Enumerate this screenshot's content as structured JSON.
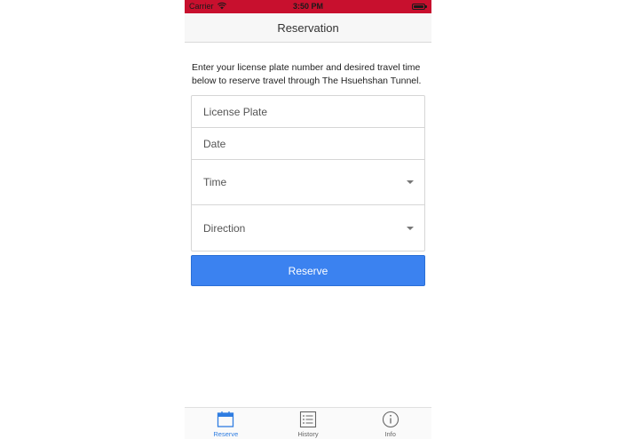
{
  "status_bar": {
    "carrier": "Carrier",
    "time": "3:50 PM",
    "background_color": "#c8102e"
  },
  "nav": {
    "title": "Reservation"
  },
  "intro": {
    "text": "Enter your license plate number and desired travel time below to reserve travel through The Hsuehshan Tunnel."
  },
  "form": {
    "license_plate": {
      "placeholder": "License Plate"
    },
    "date": {
      "placeholder": "Date"
    },
    "time": {
      "placeholder": "Time",
      "icon": "caret-down-icon"
    },
    "direction": {
      "placeholder": "Direction",
      "icon": "caret-down-icon"
    }
  },
  "reserve_button": {
    "label": "Reserve",
    "color": "#3b82f0"
  },
  "tabs": [
    {
      "label": "Reserve",
      "icon": "calendar-icon",
      "active": true,
      "color": "#2f7de1"
    },
    {
      "label": "History",
      "icon": "list-icon",
      "active": false
    },
    {
      "label": "Info",
      "icon": "info-icon",
      "active": false
    }
  ]
}
